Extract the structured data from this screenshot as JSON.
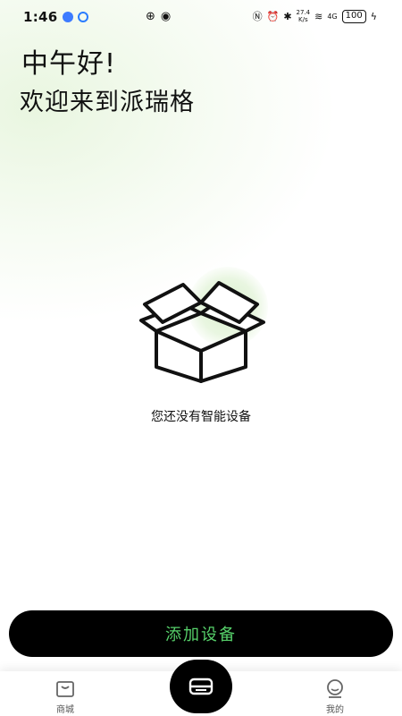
{
  "status": {
    "time": "1:46",
    "speed_top": "27.4",
    "speed_unit": "K/s",
    "network": "4G",
    "battery": "100"
  },
  "header": {
    "greeting": "中午好!",
    "welcome": "欢迎来到派瑞格"
  },
  "empty_state": {
    "message": "您还没有智能设备",
    "icon": "open-box-icon"
  },
  "actions": {
    "add_device": "添加设备"
  },
  "tabbar": {
    "items": [
      {
        "label": "商城",
        "icon": "shop-icon"
      },
      {
        "label": "",
        "icon": "device-icon"
      },
      {
        "label": "我的",
        "icon": "profile-icon"
      }
    ]
  },
  "colors": {
    "accent_text": "#56d06a",
    "button_bg": "#000000",
    "glow": "#e9f6e0"
  }
}
